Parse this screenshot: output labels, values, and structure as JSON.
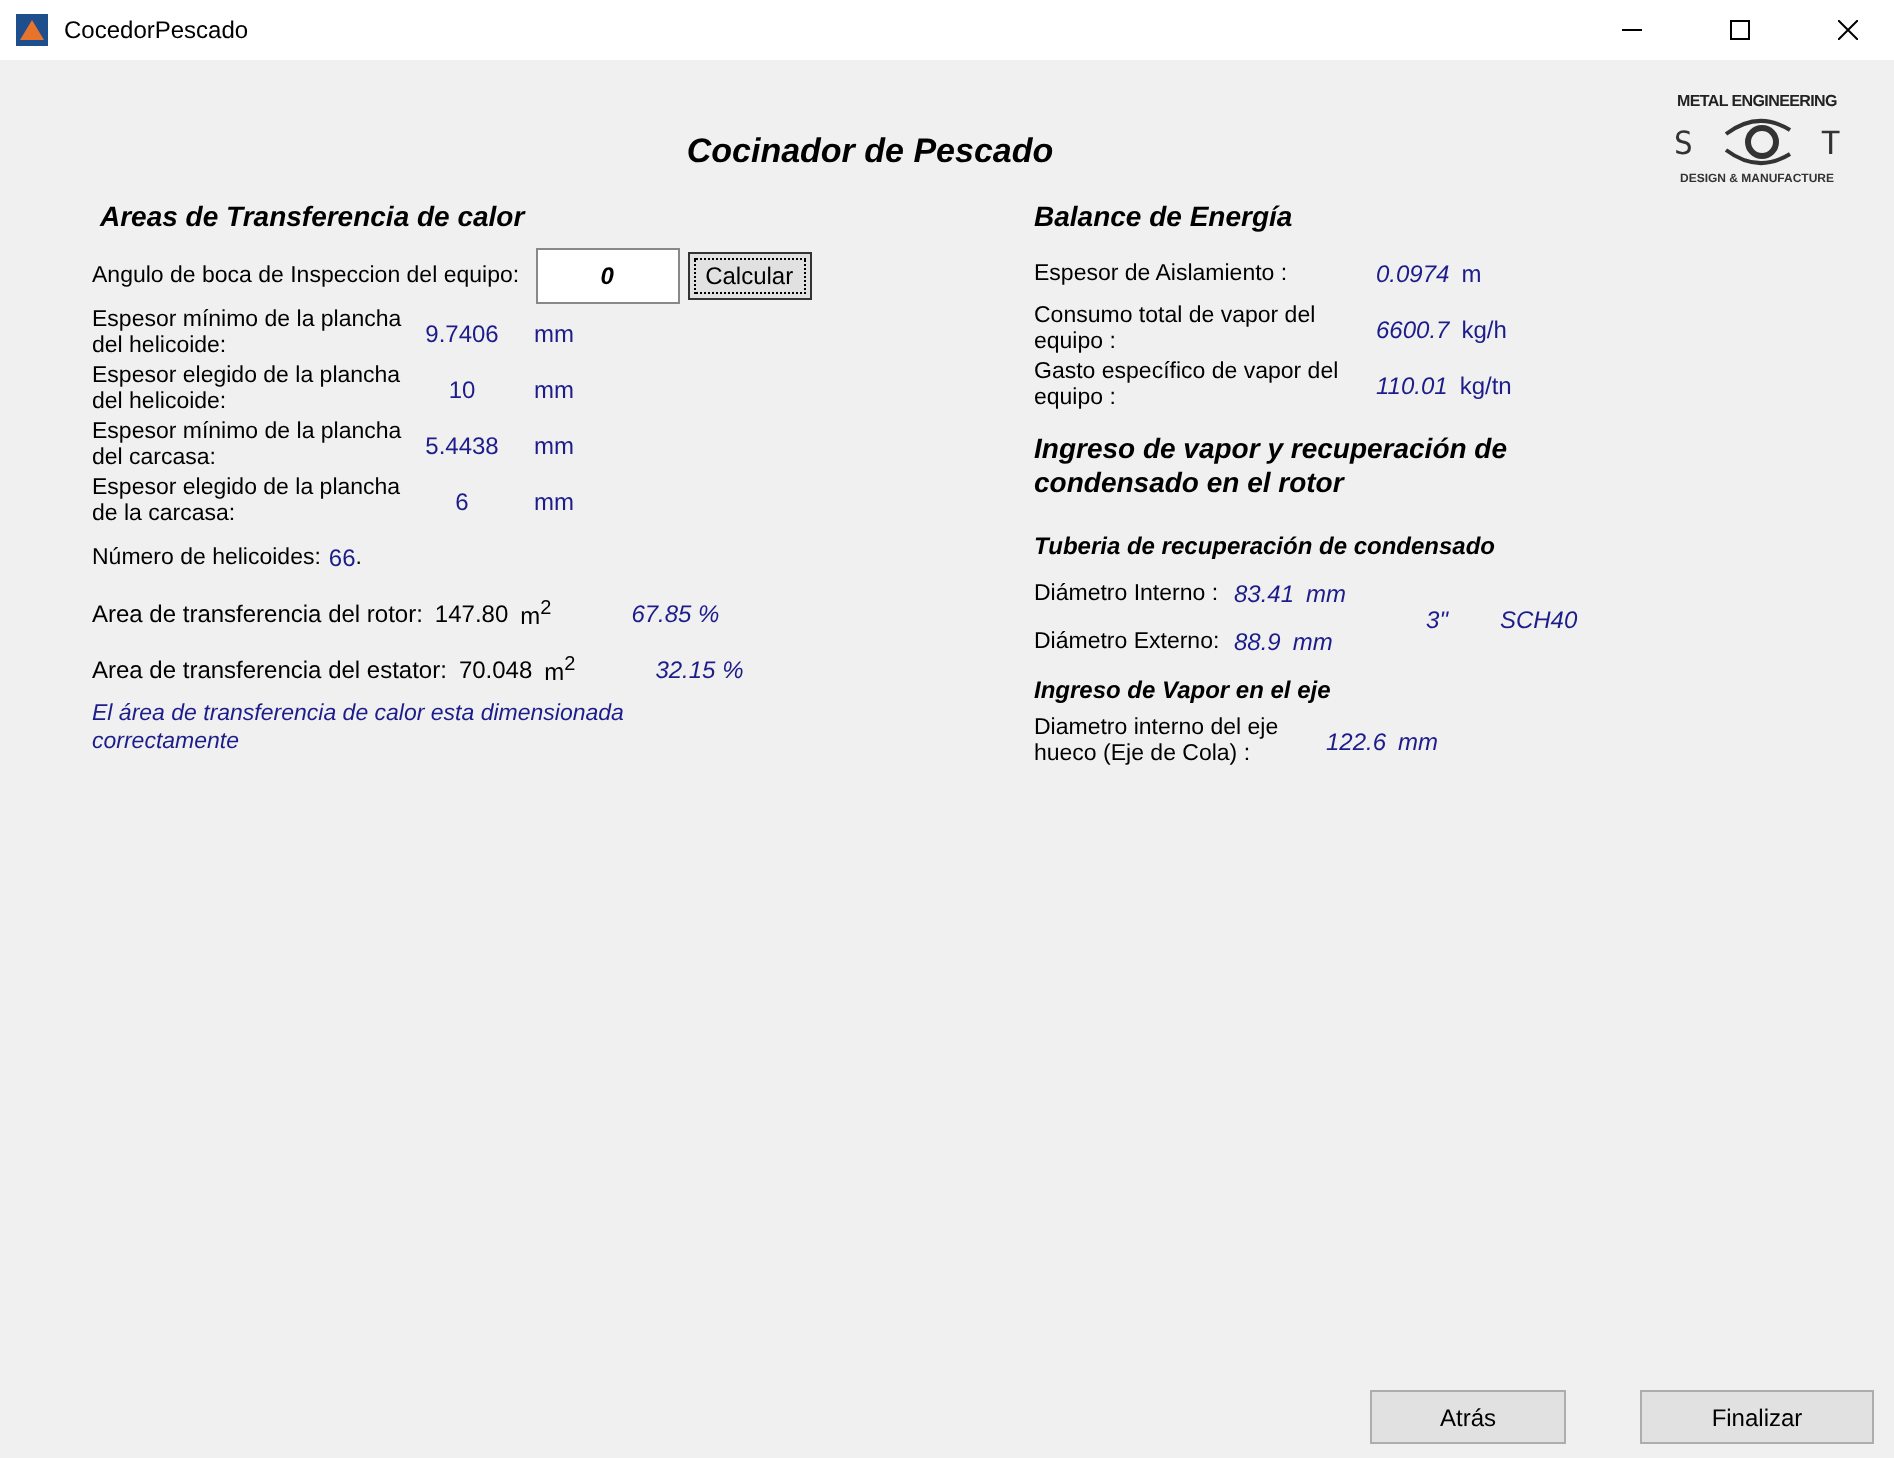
{
  "window": {
    "title": "CocedorPescado"
  },
  "title": "Cocinador de Pescado",
  "logo": {
    "top": "METAL ENGINEERING",
    "left_letter": "S",
    "right_letter": "T",
    "bottom": "DESIGN & MANUFACTURE"
  },
  "left": {
    "heading": "Areas de Transferencia de calor",
    "rows": [
      {
        "kind": "input",
        "label": "Angulo de boca de Inspeccion del equipo:",
        "value": "0",
        "button": "Calcular"
      },
      {
        "kind": "value",
        "label": "Espesor mínimo de la plancha del helicoide:",
        "value": "9.7406",
        "unit": "mm"
      },
      {
        "kind": "value",
        "label": "Espesor elegido de la plancha del helicoide:",
        "value": "10",
        "unit": "mm"
      },
      {
        "kind": "value",
        "label": "Espesor mínimo de la plancha del carcasa:",
        "value": "5.4438",
        "unit": "mm"
      },
      {
        "kind": "value",
        "label": "Espesor elegido de la plancha de la carcasa:",
        "value": "6",
        "unit": "mm"
      },
      {
        "kind": "inline",
        "label": "Número de helicoides:",
        "value": "66",
        "unit": "."
      },
      {
        "kind": "area",
        "label": "Area de transferencia del rotor:",
        "value": "147.80",
        "unit": "m$^{2}$",
        "percent": "67.85 %"
      },
      {
        "kind": "area",
        "label": "Area de transferencia del estator:",
        "value": "70.048",
        "unit": "m$^{2}$",
        "percent": "32.15 %"
      },
      {
        "kind": "message",
        "label": "El área de transferencia de calor esta dimensionada correctamente"
      }
    ]
  },
  "right": {
    "heading": "Balance de Energía",
    "rows": [
      {
        "label": "Espesor de Aislamiento :",
        "value": "0.0974",
        "unit": "m"
      },
      {
        "label": "Consumo total de vapor del equipo :",
        "value": "6600.7",
        "unit": "kg/h"
      },
      {
        "label": "Gasto específico de vapor del equipo :",
        "value": "110.01",
        "unit": "kg/tn"
      }
    ],
    "section": "Ingreso de vapor y recuperación de condensado en el rotor",
    "pipe": {
      "heading": "Tuberia de recuperación de condensado",
      "rows": [
        {
          "label": "Diámetro Interno :",
          "value": "83.41",
          "unit": "mm"
        },
        {
          "label": "Diámetro Externo:",
          "value": "88.9",
          "unit": "mm"
        }
      ],
      "size": "3\"",
      "schedule": "SCH40"
    },
    "shaft": {
      "heading": "Ingreso de Vapor en el eje",
      "label": "Diametro interno del eje hueco (Eje de Cola) :",
      "value": "122.6",
      "unit": "mm"
    }
  },
  "buttons": [
    "Atrás",
    "Finalizar"
  ]
}
